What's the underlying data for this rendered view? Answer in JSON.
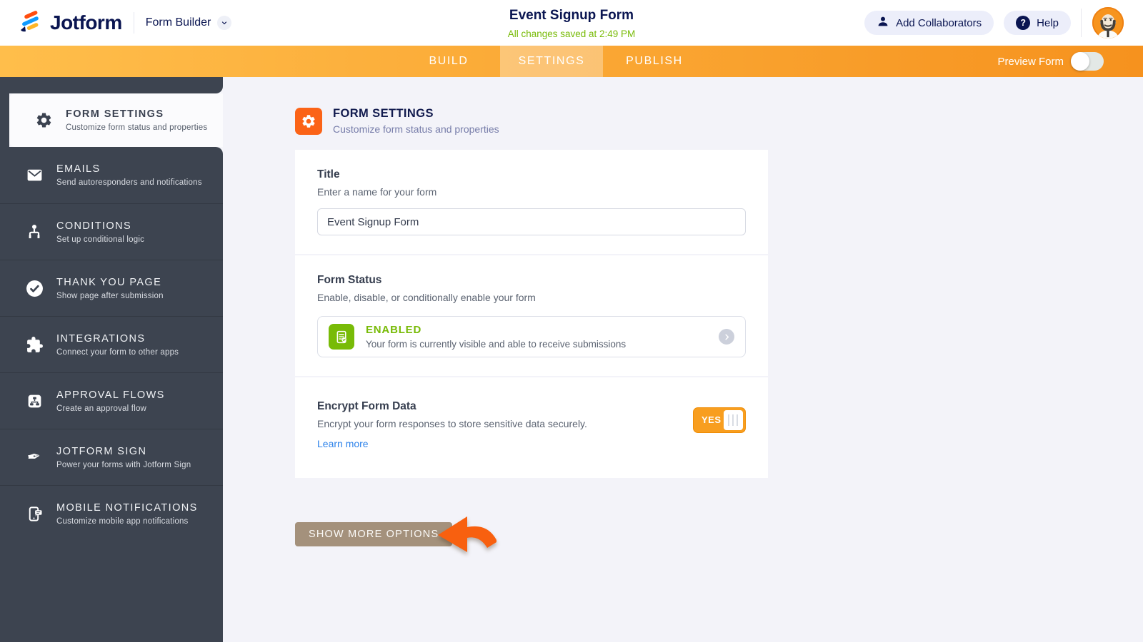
{
  "header": {
    "brand": "Jotform",
    "product": "Form Builder",
    "form_title": "Event Signup Form",
    "autosave_status": "All changes saved at 2:49 PM",
    "add_collaborators_label": "Add Collaborators",
    "help_label": "Help",
    "help_glyph": "?"
  },
  "navbar": {
    "tabs": [
      {
        "label": "BUILD",
        "active": false
      },
      {
        "label": "SETTINGS",
        "active": true
      },
      {
        "label": "PUBLISH",
        "active": false
      }
    ],
    "preview_label": "Preview Form",
    "preview_enabled": false
  },
  "sidebar": {
    "items": [
      {
        "title": "FORM SETTINGS",
        "subtitle": "Customize form status and properties",
        "icon": "gear-icon",
        "active": true
      },
      {
        "title": "EMAILS",
        "subtitle": "Send autoresponders and notifications",
        "icon": "envelope-icon",
        "active": false
      },
      {
        "title": "CONDITIONS",
        "subtitle": "Set up conditional logic",
        "icon": "sitemap-icon",
        "active": false
      },
      {
        "title": "THANK YOU PAGE",
        "subtitle": "Show page after submission",
        "icon": "check-circle-icon",
        "active": false
      },
      {
        "title": "INTEGRATIONS",
        "subtitle": "Connect your form to other apps",
        "icon": "puzzle-icon",
        "active": false
      },
      {
        "title": "APPROVAL FLOWS",
        "subtitle": "Create an approval flow",
        "icon": "workflow-icon",
        "active": false
      },
      {
        "title": "JOTFORM SIGN",
        "subtitle": "Power your forms with Jotform Sign",
        "icon": "fountain-pen-icon",
        "active": false
      },
      {
        "title": "MOBILE NOTIFICATIONS",
        "subtitle": "Customize mobile app notifications",
        "icon": "mobile-chat-icon",
        "active": false
      }
    ]
  },
  "main": {
    "section": {
      "title": "FORM SETTINGS",
      "subtitle": "Customize form status and properties"
    },
    "title_card": {
      "label": "Title",
      "description": "Enter a name for your form",
      "input_value": "Event Signup Form"
    },
    "status_card": {
      "label": "Form Status",
      "description": "Enable, disable, or conditionally enable your form",
      "status": "ENABLED",
      "status_description": "Your form is currently visible and able to receive submissions"
    },
    "encrypt_card": {
      "label": "Encrypt Form Data",
      "description": "Encrypt your form responses to store sensitive data securely.",
      "link": "Learn more",
      "toggle_value": "YES"
    },
    "show_more_label": "SHOW MORE OPTIONS"
  },
  "colors": {
    "brand_navy": "#0a1551",
    "accent_orange": "#fb6317",
    "navbar_gradient_start": "#ffbe4b",
    "navbar_gradient_end": "#f6921e",
    "saved_green": "#78bb07",
    "sidebar_dark": "#3d4450",
    "link_blue": "#2e83ea",
    "toggle_orange": "#f89e1f",
    "show_more_taupe": "#a4917c",
    "annotation_arrow_orange": "#f8600f"
  }
}
